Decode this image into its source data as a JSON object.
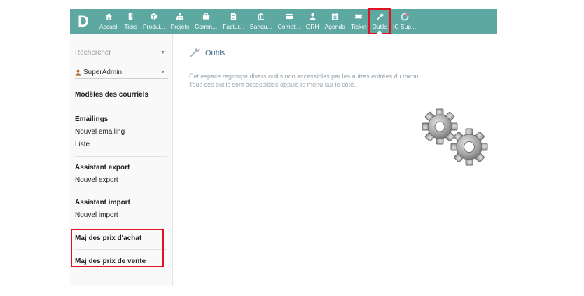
{
  "app": {
    "logo_letter": "D"
  },
  "topnav": {
    "items": [
      {
        "label": "Accueil",
        "icon": "home-icon"
      },
      {
        "label": "Tiers",
        "icon": "building-icon"
      },
      {
        "label": "Produi...",
        "icon": "cube-icon"
      },
      {
        "label": "Projets",
        "icon": "sitemap-icon"
      },
      {
        "label": "Comm...",
        "icon": "briefcase-icon"
      },
      {
        "label": "Factur...",
        "icon": "invoice-icon"
      },
      {
        "label": "Banqu...",
        "icon": "bank-icon"
      },
      {
        "label": "Compt...",
        "icon": "ledger-icon"
      },
      {
        "label": "GRH",
        "icon": "user-icon"
      },
      {
        "label": "Agenda",
        "icon": "calendar-icon"
      },
      {
        "label": "Ticket",
        "icon": "ticket-icon"
      },
      {
        "label": "Outils",
        "icon": "wrench-icon",
        "active": true
      },
      {
        "label": "IC Sup...",
        "icon": "module-icon"
      }
    ]
  },
  "sidebar": {
    "search_placeholder": "Rechercher",
    "user_name": "SuperAdmin",
    "groups": [
      {
        "title": "Modèles des courriels",
        "links": []
      },
      {
        "title": "Emailings",
        "links": [
          "Nouvel emailing",
          "Liste"
        ]
      },
      {
        "title": "Assistant export",
        "links": [
          "Nouvel export"
        ]
      },
      {
        "title": "Assistant import",
        "links": [
          "Nouvel import"
        ]
      },
      {
        "title": "Maj des prix d'achat",
        "links": []
      },
      {
        "title": "Maj des prix de vente",
        "links": []
      }
    ]
  },
  "main": {
    "title": "Outils",
    "description_line1": "Cet espace regroupe divers outils non accessibles par les autres entrées du menu.",
    "description_line2": "Tous ces outils sont accessibles depuis le menu sur le côté.."
  },
  "colors": {
    "topbar": "#5ea8a2",
    "highlight": "#e0121f",
    "title": "#3c6e8f",
    "description": "#9aa5ad"
  }
}
